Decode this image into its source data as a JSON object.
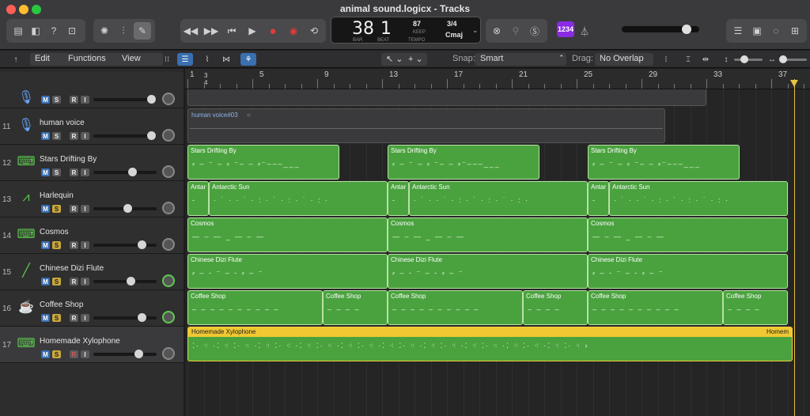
{
  "window": {
    "title": "animal sound.logicx - Tracks"
  },
  "lcd": {
    "bar": "38",
    "beat": "1",
    "bar_label": "BAR",
    "beat_label": "BEAT",
    "tempo": "87",
    "tempo_mode": "KEEP",
    "tempo_label": "TEMPO",
    "signature": "3/4",
    "key": "Cmaj"
  },
  "toolbar_badge": "1234",
  "trackbar": {
    "edit": "Edit",
    "functions": "Functions",
    "view": "View",
    "snap_label": "Snap:",
    "snap_value": "Smart",
    "drag_label": "Drag:",
    "drag_value": "No Overlap"
  },
  "header_area": {
    "solo_label": "S"
  },
  "ruler": {
    "bars": [
      "1",
      "5",
      "9",
      "13",
      "17",
      "21",
      "25",
      "29",
      "33",
      "37"
    ],
    "sig_top": "3",
    "sig_bottom": "4"
  },
  "tracks": [
    {
      "num": "",
      "name": "",
      "solo": false
    },
    {
      "num": "11",
      "name": "human voice",
      "solo": false
    },
    {
      "num": "12",
      "name": "Stars Drifting By",
      "solo": false
    },
    {
      "num": "13",
      "name": "Harlequin",
      "solo": true
    },
    {
      "num": "14",
      "name": "Cosmos",
      "solo": true
    },
    {
      "num": "15",
      "name": "Chinese Dizi Flute",
      "solo": true
    },
    {
      "num": "16",
      "name": "Coffee Shop",
      "solo": true
    },
    {
      "num": "17",
      "name": "Homemade Xylophone",
      "solo": true
    }
  ],
  "button_labels": {
    "m": "M",
    "s": "S",
    "r": "R",
    "i": "I"
  },
  "regions": {
    "human_voice": "human voice#03",
    "stars": "Stars Drifting By",
    "antar": "Antar",
    "antarctic": "Antarctic Sun",
    "cosmos": "Cosmos",
    "dizi": "Chinese Dizi Flute",
    "coffee": "Coffee Shop",
    "xylo": "Homemade Xylophone",
    "xylo_end": "Homem"
  },
  "colors": {
    "region_green": "#4aa23e",
    "xylo_yellow": "#f0c832",
    "playhead": "#e8c23c"
  }
}
